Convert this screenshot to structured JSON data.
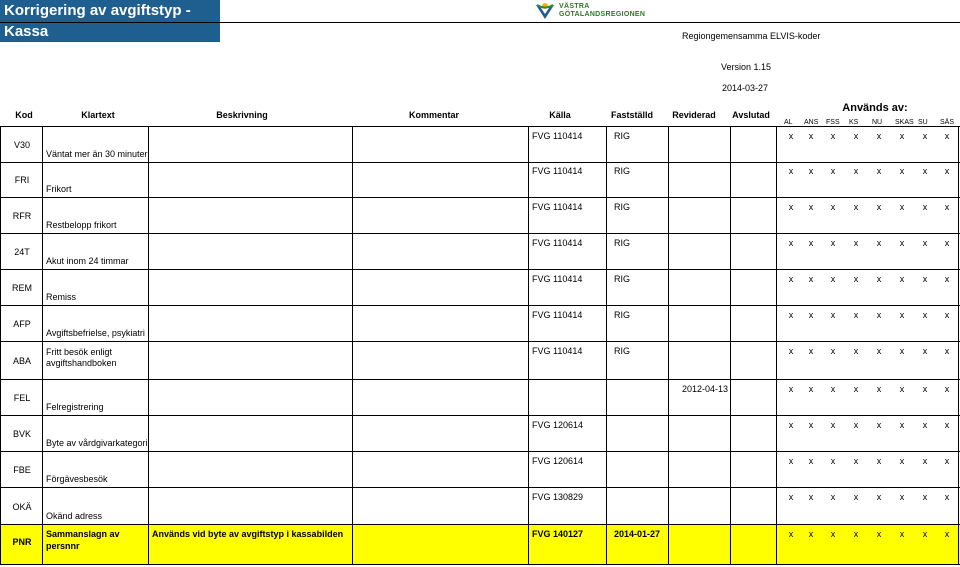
{
  "title": "Korrigering av avgiftstyp - Kassa",
  "logo": {
    "line1": "VÄSTRA",
    "line2": "GÖTALANDSREGIONEN"
  },
  "meta": {
    "org": "Regiongemensamma ELVIS-koder",
    "version": "Version 1.15",
    "date": "2014-03-27"
  },
  "headers": {
    "kod": "Kod",
    "klartext": "Klartext",
    "beskrivning": "Beskrivning",
    "kommentar": "Kommentar",
    "kalla": "Källa",
    "faststalld": "Fastställd",
    "reviderad": "Reviderad",
    "avslutad": "Avslutad",
    "anvands": "Används av:",
    "users": [
      "AL",
      "ANS",
      "FSS",
      "KS",
      "NU",
      "SKAS",
      "SU",
      "SÄS"
    ]
  },
  "rows": [
    {
      "kod": "V30",
      "klartext": "Väntat mer än 30 minuter",
      "beskrivning": "",
      "kommentar": "",
      "kalla": "FVG 110414",
      "faststalld": "RIG",
      "reviderad": "",
      "avslutad": "",
      "marks": [
        "x",
        "x",
        "x",
        "x",
        "x",
        "x",
        "x",
        "x"
      ]
    },
    {
      "kod": "FRI",
      "klartext": "Frikort",
      "beskrivning": "",
      "kommentar": "",
      "kalla": "FVG 110414",
      "faststalld": "RIG",
      "reviderad": "",
      "avslutad": "",
      "marks": [
        "x",
        "x",
        "x",
        "x",
        "x",
        "x",
        "x",
        "x"
      ]
    },
    {
      "kod": "RFR",
      "klartext": "Restbelopp frikort",
      "beskrivning": "",
      "kommentar": "",
      "kalla": "FVG 110414",
      "faststalld": "RIG",
      "reviderad": "",
      "avslutad": "",
      "marks": [
        "x",
        "x",
        "x",
        "x",
        "x",
        "x",
        "x",
        "x"
      ]
    },
    {
      "kod": "24T",
      "klartext": "Akut inom 24 timmar",
      "beskrivning": "",
      "kommentar": "",
      "kalla": "FVG 110414",
      "faststalld": "RIG",
      "reviderad": "",
      "avslutad": "",
      "marks": [
        "x",
        "x",
        "x",
        "x",
        "x",
        "x",
        "x",
        "x"
      ]
    },
    {
      "kod": "REM",
      "klartext": "Remiss",
      "beskrivning": "",
      "kommentar": "",
      "kalla": "FVG 110414",
      "faststalld": "RIG",
      "reviderad": "",
      "avslutad": "",
      "marks": [
        "x",
        "x",
        "x",
        "x",
        "x",
        "x",
        "x",
        "x"
      ]
    },
    {
      "kod": "AFP",
      "klartext": "Avgiftsbefrielse, psykiatri",
      "beskrivning": "",
      "kommentar": "",
      "kalla": "FVG 110414",
      "faststalld": "RIG",
      "reviderad": "",
      "avslutad": "",
      "marks": [
        "x",
        "x",
        "x",
        "x",
        "x",
        "x",
        "x",
        "x"
      ]
    },
    {
      "kod": "ABA",
      "klartext": "Fritt besök enligt avgiftshandboken",
      "beskrivning": "",
      "kommentar": "",
      "kalla": "FVG 110414",
      "faststalld": "RIG",
      "reviderad": "",
      "avslutad": "",
      "marks": [
        "x",
        "x",
        "x",
        "x",
        "x",
        "x",
        "x",
        "x"
      ]
    },
    {
      "kod": "FEL",
      "klartext": "Felregistrering",
      "beskrivning": "",
      "kommentar": "",
      "kalla": "",
      "faststalld": "",
      "reviderad": "2012-04-13",
      "avslutad": "",
      "marks": [
        "x",
        "x",
        "x",
        "x",
        "x",
        "x",
        "x",
        "x"
      ]
    },
    {
      "kod": "BVK",
      "klartext": "Byte av vårdgivarkategori",
      "beskrivning": "",
      "kommentar": "",
      "kalla": "FVG 120614",
      "faststalld": "",
      "reviderad": "",
      "avslutad": "",
      "marks": [
        "x",
        "x",
        "x",
        "x",
        "x",
        "x",
        "x",
        "x"
      ]
    },
    {
      "kod": "FBE",
      "klartext": "Förgävesbesök",
      "beskrivning": "",
      "kommentar": "",
      "kalla": "FVG 120614",
      "faststalld": "",
      "reviderad": "",
      "avslutad": "",
      "marks": [
        "x",
        "x",
        "x",
        "x",
        "x",
        "x",
        "x",
        "x"
      ]
    },
    {
      "kod": "OKÄ",
      "klartext": "Okänd adress",
      "beskrivning": "",
      "kommentar": "",
      "kalla": "FVG 130829",
      "faststalld": "",
      "reviderad": "",
      "avslutad": "",
      "marks": [
        "x",
        "x",
        "x",
        "x",
        "x",
        "x",
        "x",
        "x"
      ]
    },
    {
      "kod": "PNR",
      "klartext": "Sammanslagn av persnnr",
      "beskrivning": "Används vid byte av avgiftstyp i kassabilden",
      "kommentar": "",
      "kalla": "FVG 140127",
      "faststalld": "2014-01-27",
      "reviderad": "",
      "avslutad": "",
      "marks": [
        "x",
        "x",
        "x",
        "x",
        "x",
        "x",
        "x",
        "x"
      ],
      "highlight": true
    }
  ]
}
